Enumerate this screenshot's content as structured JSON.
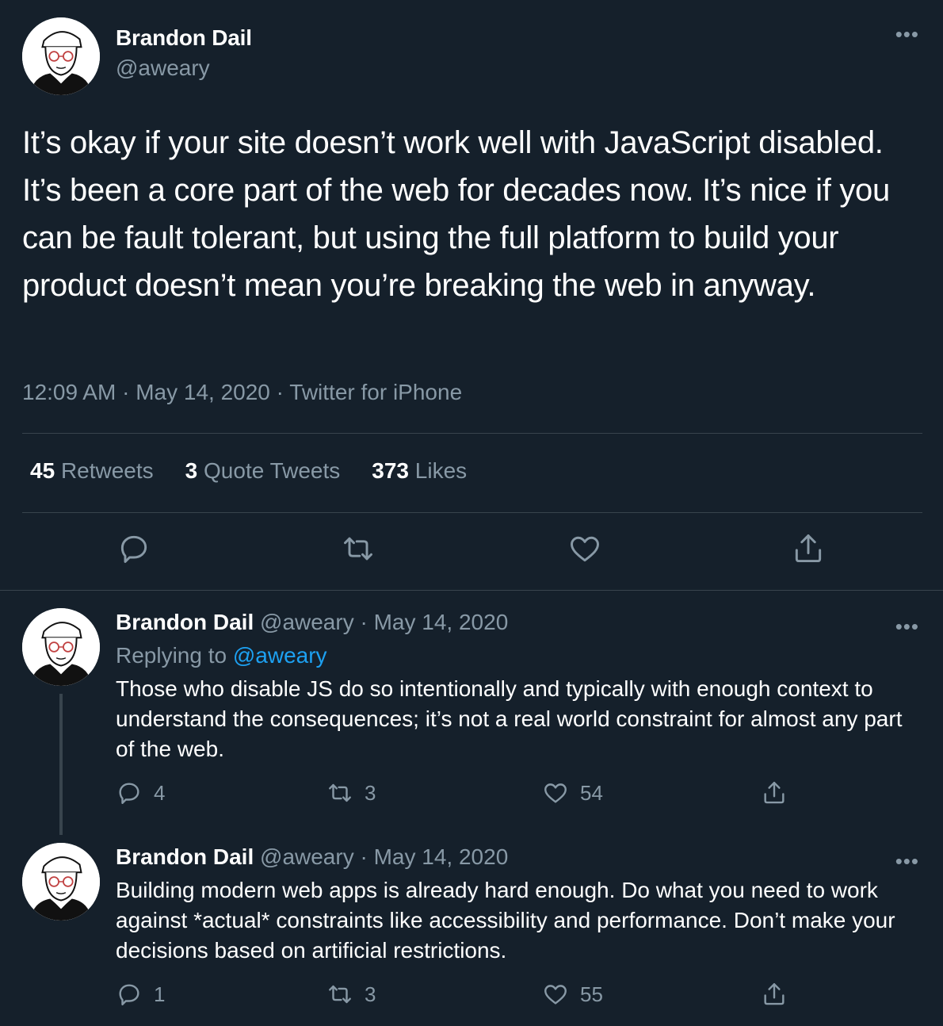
{
  "main": {
    "author_name": "Brandon Dail",
    "author_handle": "@aweary",
    "more_label": "•••",
    "text": "It’s okay if your site doesn’t work well with JavaScript disabled. It’s been a core part of the web for decades now. It’s nice if you can be fault tolerant, but using the full platform to build your product doesn’t mean you’re breaking the web in anyway.",
    "time": "12:09 AM",
    "sep1": " · ",
    "date": "May 14, 2020",
    "sep2": " · ",
    "source": "Twitter for iPhone",
    "stats": {
      "retweets_count": "45",
      "retweets_label": "Retweets",
      "quotes_count": "3",
      "quotes_label": "Quote Tweets",
      "likes_count": "373",
      "likes_label": "Likes"
    },
    "icons": [
      "reply-icon",
      "retweet-icon",
      "like-icon",
      "share-icon"
    ]
  },
  "replies": [
    {
      "author_name": "Brandon Dail",
      "author_handle": "@aweary",
      "separator": " · ",
      "date": "May 14, 2020",
      "replying_prefix": "Replying to ",
      "replying_handle": "@aweary",
      "text": "Those who disable JS do so intentionally and typically with enough context to understand the consequences; it’s not a real world constraint for almost any part of the web.",
      "reply_count": "4",
      "retweet_count": "3",
      "like_count": "54",
      "more_label": "•••"
    },
    {
      "author_name": "Brandon Dail",
      "author_handle": "@aweary",
      "separator": " · ",
      "date": "May 14, 2020",
      "text": "Building modern web apps is already hard enough. Do what you need to work against *actual* constraints like accessibility and performance. Don’t make your decisions based on artificial restrictions.",
      "reply_count": "1",
      "retweet_count": "3",
      "like_count": "55",
      "more_label": "•••"
    }
  ],
  "colors": {
    "background": "#15202b",
    "secondary_text": "#8899a6",
    "link": "#1da1f2",
    "divider": "#38444d"
  }
}
